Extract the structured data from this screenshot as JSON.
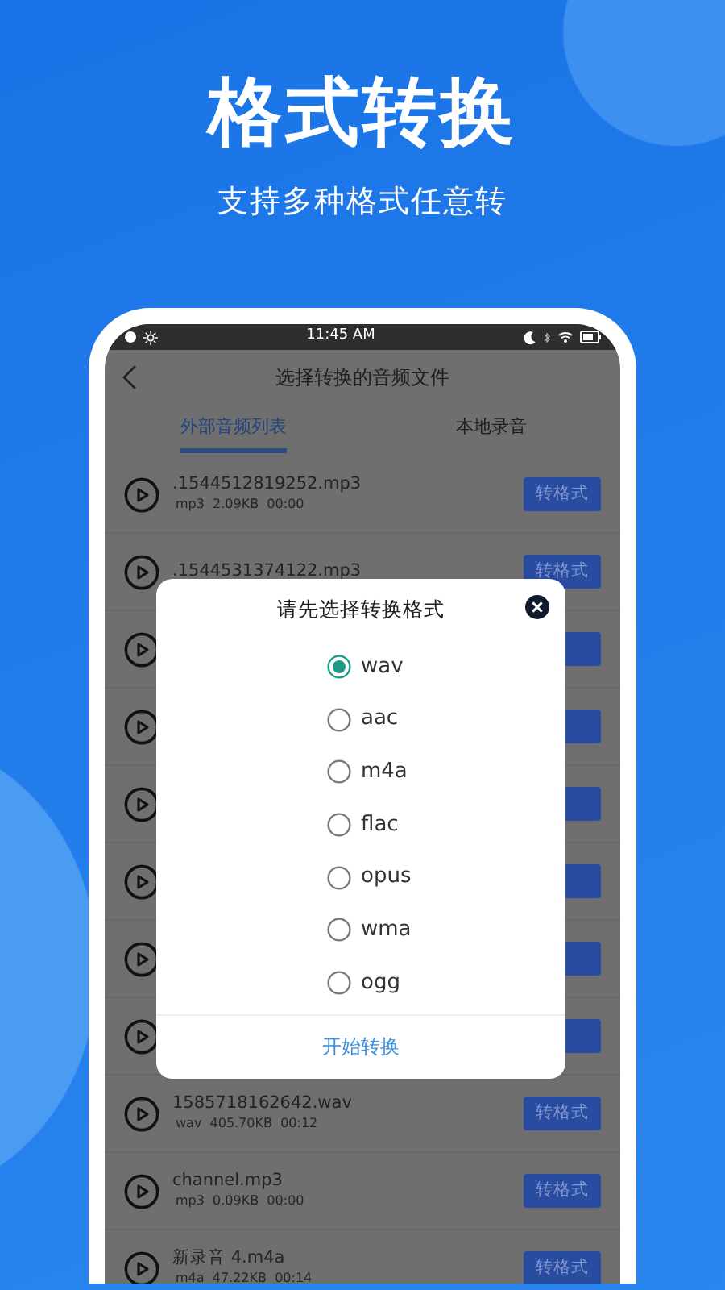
{
  "headline": "格式转换",
  "subheadline": "支持多种格式任意转",
  "status_bar": {
    "time": "11:45 AM"
  },
  "header": {
    "title": "选择转换的音频文件"
  },
  "tabs": [
    {
      "label": "外部音频列表",
      "selected": true
    },
    {
      "label": "本地录音",
      "selected": false
    }
  ],
  "files": [
    {
      "kind": "file",
      "name": ".1544512819252.mp3",
      "meta": "mp3  2.09KB  00:00",
      "button": "转格式"
    },
    {
      "kind": "file",
      "name": ".1544531374122.mp3",
      "button": "转格式"
    },
    {
      "kind": "covered"
    },
    {
      "kind": "covered"
    },
    {
      "kind": "covered"
    },
    {
      "kind": "covered"
    },
    {
      "kind": "covered"
    },
    {
      "kind": "covered"
    },
    {
      "kind": "file",
      "name": "1585718162642.wav",
      "meta": "wav  405.70KB  00:12",
      "button": "转格式"
    },
    {
      "kind": "file",
      "name": "channel.mp3",
      "meta": "mp3  0.09KB  00:00",
      "button": "转格式"
    },
    {
      "kind": "file",
      "name": "新录音 4.m4a",
      "meta": "m4a  47.22KB  00:14",
      "button": "转格式"
    }
  ],
  "dialog": {
    "title": "请先选择转换格式",
    "options": [
      {
        "label": "wav",
        "selected": true
      },
      {
        "label": "aac",
        "selected": false
      },
      {
        "label": "m4a",
        "selected": false
      },
      {
        "label": "flac",
        "selected": false
      },
      {
        "label": "opus",
        "selected": false
      },
      {
        "label": "wma",
        "selected": false
      },
      {
        "label": "ogg",
        "selected": false
      }
    ],
    "action": "开始转换"
  }
}
